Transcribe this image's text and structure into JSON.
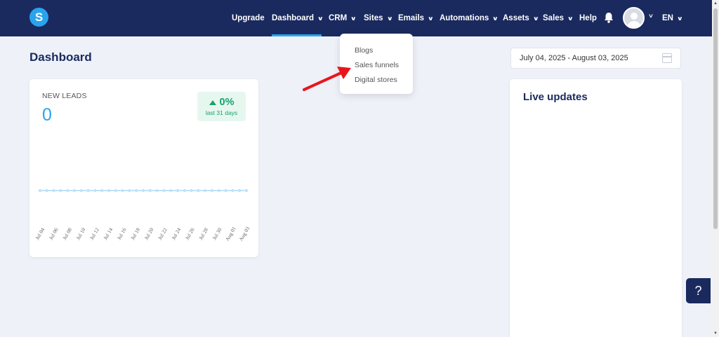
{
  "brand": {
    "logo_letter": "S"
  },
  "nav": {
    "items": [
      {
        "label": "Upgrade",
        "has_menu": false
      },
      {
        "label": "Dashboard",
        "has_menu": true,
        "active": true
      },
      {
        "label": "CRM",
        "has_menu": true
      },
      {
        "label": "Sites",
        "has_menu": true
      },
      {
        "label": "Emails",
        "has_menu": true
      },
      {
        "label": "Automations",
        "has_menu": true
      },
      {
        "label": "Assets",
        "has_menu": true
      },
      {
        "label": "Sales",
        "has_menu": true
      },
      {
        "label": "Help",
        "has_menu": false
      }
    ],
    "language": "EN"
  },
  "sites_menu": {
    "items": [
      "Blogs",
      "Sales funnels",
      "Digital stores"
    ]
  },
  "page": {
    "title": "Dashboard",
    "date_range": "July 04, 2025 - August 03, 2025"
  },
  "leads": {
    "label": "NEW LEADS",
    "value": "0",
    "change": "0%",
    "change_caption": "last 31 days"
  },
  "live": {
    "title": "Live updates"
  },
  "help": {
    "label": "?"
  },
  "chart_data": {
    "type": "line",
    "title": "",
    "xlabel": "",
    "ylabel": "",
    "categories": [
      "Jul 04",
      "Jul 06",
      "Jul 08",
      "Jul 10",
      "Jul 12",
      "Jul 14",
      "Jul 16",
      "Jul 18",
      "Jul 20",
      "Jul 22",
      "Jul 24",
      "Jul 26",
      "Jul 28",
      "Jul 30",
      "Aug 01",
      "Aug 03"
    ],
    "series": [
      {
        "values": [
          0,
          0,
          0,
          0,
          0,
          0,
          0,
          0,
          0,
          0,
          0,
          0,
          0,
          0,
          0,
          0,
          0,
          0,
          0,
          0,
          0,
          0,
          0,
          0,
          0,
          0,
          0,
          0,
          0,
          0,
          0
        ]
      }
    ],
    "grid": false,
    "color": "#bfe2f8"
  },
  "colors": {
    "nav_bg": "#1a2a5e",
    "accent": "#2aa3ef",
    "positive": "#17a36a",
    "annotation_arrow": "#e8161b"
  }
}
